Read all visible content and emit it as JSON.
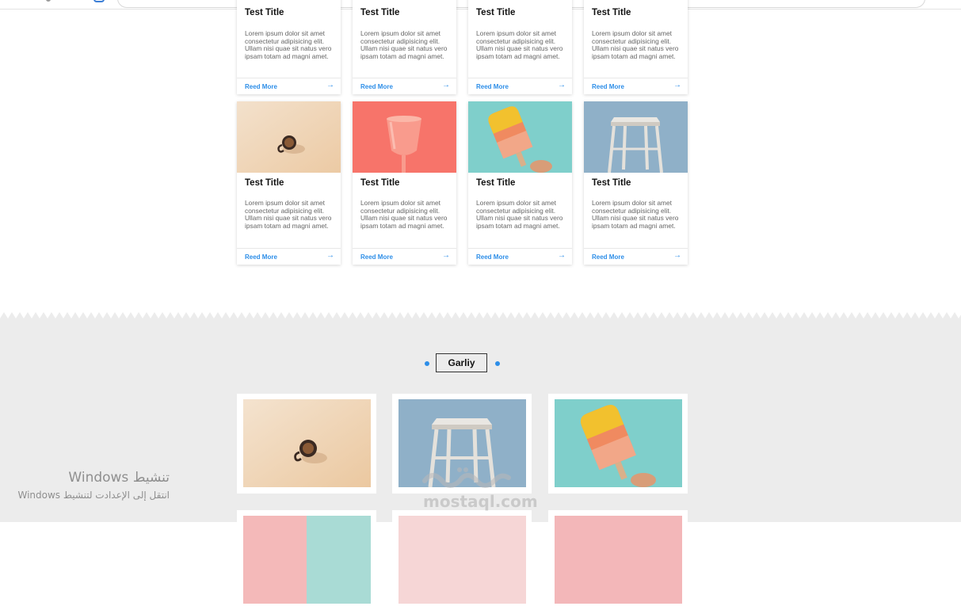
{
  "cards": [
    {
      "title": "Test Title",
      "text": "Lorem ipsum dolor sit amet consectetur adipisicing elit. Ullam nisi quae sit natus vero ipsam totam ad magni amet.",
      "link": "Reed More",
      "image": "none",
      "arrow": "→"
    },
    {
      "title": "Test Title",
      "text": "Lorem ipsum dolor sit amet consectetur adipisicing elit. Ullam nisi quae sit natus vero ipsam totam ad magni amet.",
      "link": "Reed More",
      "image": "none",
      "arrow": "→"
    },
    {
      "title": "Test Title",
      "text": "Lorem ipsum dolor sit amet consectetur adipisicing elit. Ullam nisi quae sit natus vero ipsam totam ad magni amet.",
      "link": "Reed More",
      "image": "none",
      "arrow": "→"
    },
    {
      "title": "Test Title",
      "text": "Lorem ipsum dolor sit amet consectetur adipisicing elit. Ullam nisi quae sit natus vero ipsam totam ad magni amet.",
      "link": "Reed More",
      "image": "none",
      "arrow": "→"
    },
    {
      "title": "Test Title",
      "text": "Lorem ipsum dolor sit amet consectetur adipisicing elit. Ullam nisi quae sit natus vero ipsam totam ad magni amet.",
      "link": "Reed More",
      "image": "coffee-mug-photo",
      "arrow": "→"
    },
    {
      "title": "Test Title",
      "text": "Lorem ipsum dolor sit amet consectetur adipisicing elit. Ullam nisi quae sit natus vero ipsam totam ad magni amet.",
      "link": "Reed More",
      "image": "pink-glass-photo",
      "arrow": "→"
    },
    {
      "title": "Test Title",
      "text": "Lorem ipsum dolor sit amet consectetur adipisicing elit. Ullam nisi quae sit natus vero ipsam totam ad magni amet.",
      "link": "Reed More",
      "image": "popsicle-photo",
      "arrow": "→"
    },
    {
      "title": "Test Title",
      "text": "Lorem ipsum dolor sit amet consectetur adipisicing elit. Ullam nisi quae sit natus vero ipsam totam ad magni amet.",
      "link": "Reed More",
      "image": "stool-photo",
      "arrow": "→"
    }
  ],
  "gallery": {
    "heading": "Garliy",
    "images": [
      "coffee-mug-photo",
      "stool-photo",
      "popsicle-photo",
      "pink-pastel-photo",
      "pink-pastel-photo",
      "pink-pastel-photo"
    ]
  },
  "watermark": {
    "activate_title": "تنشيط Windows",
    "activate_hint": "انتقل إلى الإعدادت لتنشيط Windows"
  },
  "brand": {
    "logo_text": "mostaql.com"
  },
  "colors": {
    "accent": "#2d8ee8",
    "section_bg": "#ececec",
    "card_bg": "#ffffff"
  }
}
